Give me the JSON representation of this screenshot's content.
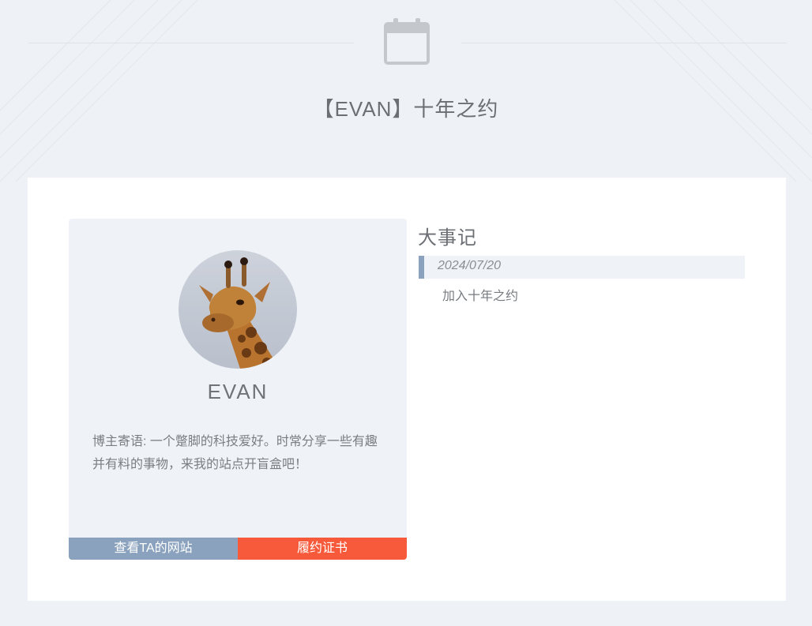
{
  "header": {
    "title": "【EVAN】十年之约",
    "icon": "calendar-icon"
  },
  "profile": {
    "name": "EVAN",
    "bio": "博主寄语: 一个蹩脚的科技爱好。时常分享一些有趣并有料的事物，来我的站点开盲盒吧！",
    "avatar_icon": "giraffe-avatar",
    "buttons": {
      "view_site": "查看TA的网站",
      "certificate": "履约证书"
    }
  },
  "events": {
    "title": "大事记",
    "items": [
      {
        "date": "2024/07/20",
        "description": "加入十年之约"
      }
    ]
  },
  "colors": {
    "page_bg": "#eef2f6",
    "card_bg": "#eff3f7",
    "accent_blue": "#8aa2bd",
    "accent_red": "#f75a3a"
  }
}
